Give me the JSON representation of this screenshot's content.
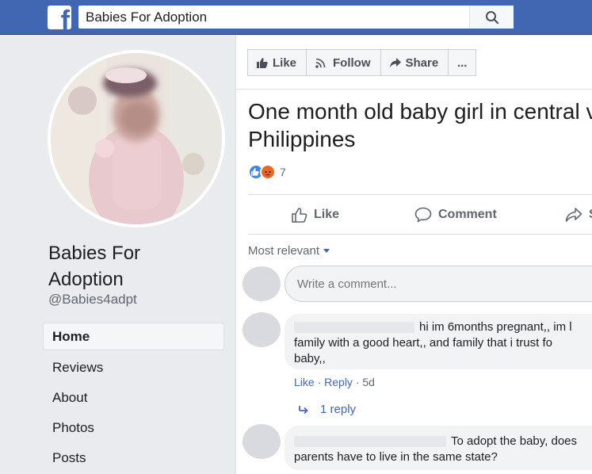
{
  "topbar": {
    "logo_glyph": "f",
    "search_value": "Babies For Adoption",
    "search_icon": "magnifier-icon"
  },
  "sidebar": {
    "page_name": "Babies For Adoption",
    "handle": "@Babies4adpt",
    "nav": [
      {
        "label": "Home",
        "active": true
      },
      {
        "label": "Reviews",
        "active": false
      },
      {
        "label": "About",
        "active": false
      },
      {
        "label": "Photos",
        "active": false
      },
      {
        "label": "Posts",
        "active": false
      }
    ]
  },
  "actions": {
    "like": "Like",
    "follow": "Follow",
    "share": "Share",
    "more": "..."
  },
  "post": {
    "title_line1": "One month old baby girl in central v",
    "title_line2": "Philippines",
    "reaction_count": "7",
    "like_label": "Like",
    "comment_label": "Comment",
    "share_label": "S"
  },
  "comments": {
    "sort_label": "Most relevant",
    "write_placeholder": "Write a comment...",
    "items": [
      {
        "text_line1": "hi im 6months pregnant,, im l",
        "text_line2": "family with a good heart,, and family that i trust fo",
        "text_line3": "baby,,",
        "like": "Like",
        "reply": "Reply",
        "time": "5d",
        "replies": "1 reply"
      },
      {
        "text_line1": "To adopt the baby, does",
        "text_line2": "parents have to live in the same state?"
      }
    ]
  },
  "colors": {
    "brand": "#4267b2",
    "link": "#4267b2",
    "like_reaction": "#3b87f5",
    "angry_reaction": "#f16524"
  }
}
